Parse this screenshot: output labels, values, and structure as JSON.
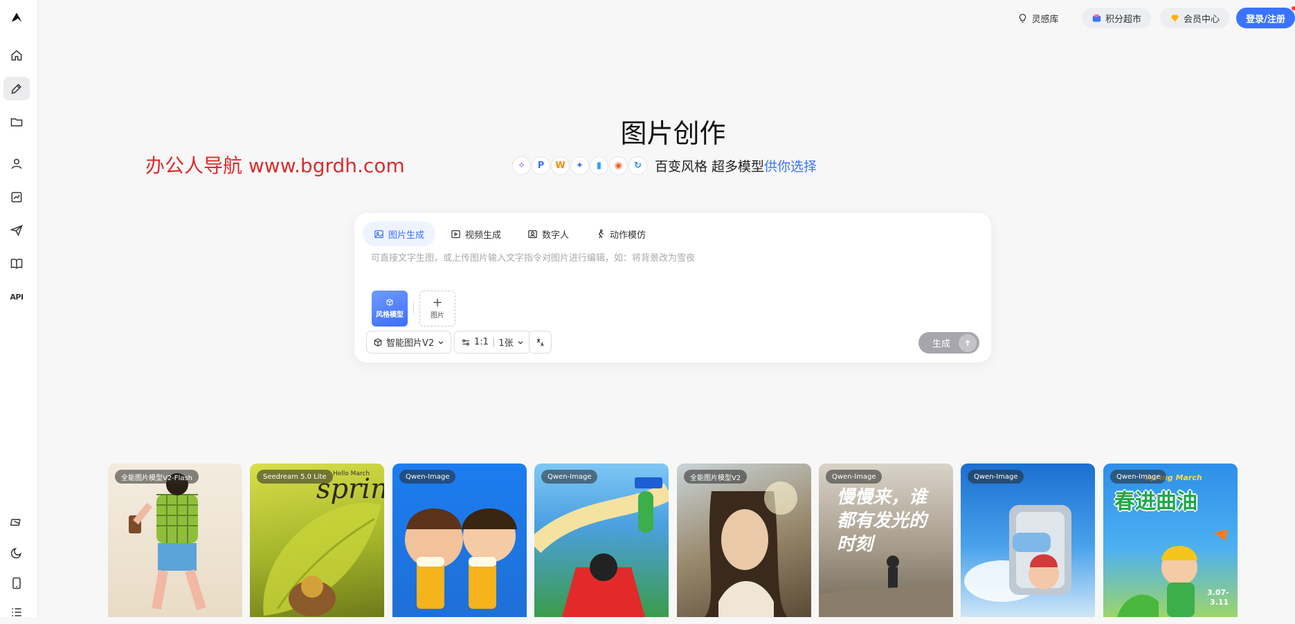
{
  "sidebar": {
    "items": [
      {
        "id": "logo",
        "icon": "brand-logo-icon"
      },
      {
        "id": "home",
        "icon": "home-icon"
      },
      {
        "id": "create",
        "icon": "edit-icon",
        "active": true
      },
      {
        "id": "files",
        "icon": "folder-icon"
      },
      {
        "id": "user",
        "icon": "user-icon"
      },
      {
        "id": "stats",
        "icon": "chart-icon"
      },
      {
        "id": "send",
        "icon": "send-icon"
      },
      {
        "id": "docs",
        "icon": "book-icon"
      },
      {
        "id": "api",
        "label": "API"
      }
    ],
    "bottom": [
      {
        "id": "switch",
        "icon": "switch-icon"
      },
      {
        "id": "theme",
        "icon": "moon-icon"
      },
      {
        "id": "mobile",
        "icon": "tablet-icon"
      },
      {
        "id": "menu",
        "icon": "list-icon"
      }
    ]
  },
  "topbar": {
    "inspiration": "灵感库",
    "points_market": "积分超市",
    "member_center": "会员中心",
    "login": "登录/注册"
  },
  "hero": {
    "title": "图片创作",
    "subtitle_main": "百变风格 超多模型",
    "subtitle_blue": "供你选择"
  },
  "watermark": "办公人导航 www.bgrdh.com",
  "card": {
    "tabs": [
      {
        "label": "图片生成",
        "icon": "image-icon",
        "active": true
      },
      {
        "label": "视频生成",
        "icon": "video-icon"
      },
      {
        "label": "数字人",
        "icon": "digital-human-icon"
      },
      {
        "label": "动作模仿",
        "icon": "run-icon"
      }
    ],
    "prompt_placeholder": "可直接文字生图，或上传图片输入文字指令对图片进行编辑，如：将背景改为雪夜",
    "style_model": "风格模型",
    "add_image": "图片",
    "model_select": "智能图片V2",
    "ratio": "1:1",
    "count": "1张",
    "generate": "生成"
  },
  "gallery": [
    {
      "badge": "全能图片模型V2-Flash"
    },
    {
      "badge": "Seedream 5.0 Lite",
      "overlay": "spring",
      "overlay_small": "Hello March"
    },
    {
      "badge": "Qwen-Image"
    },
    {
      "badge": "Qwen-Image"
    },
    {
      "badge": "全能图片模型V2"
    },
    {
      "badge": "Qwen-Image",
      "overlay": "慢慢来，谁都有发光的时刻"
    },
    {
      "badge": "Qwen-Image"
    },
    {
      "badge": "Qwen-Image",
      "overlay": "春进曲油",
      "overlay_small": "Spring March"
    }
  ]
}
